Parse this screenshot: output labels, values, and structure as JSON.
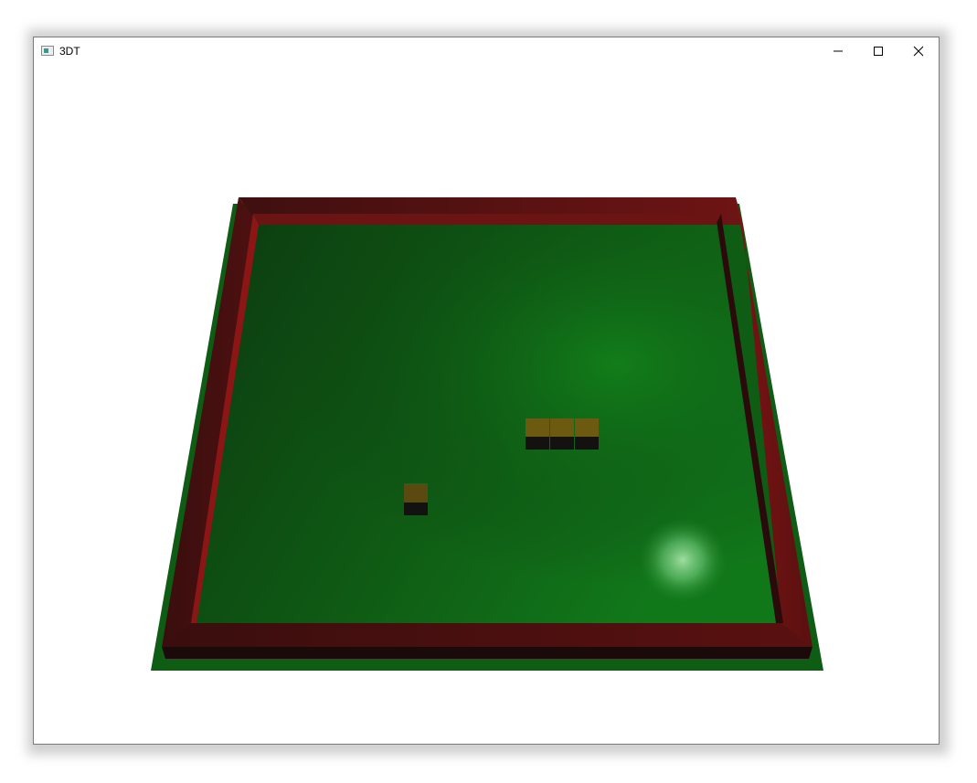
{
  "window": {
    "title": "3DT",
    "controls": {
      "minimize_icon": "minimize-icon",
      "maximize_icon": "maximize-icon",
      "close_icon": "close-icon"
    }
  },
  "scene": {
    "colors": {
      "floor_light": "#127a16",
      "floor_dark": "#0c3a10",
      "floor_edge": "#0f5c14",
      "wall_top": "#6a1414",
      "wall_top_dark": "#3f0f0f",
      "wall_inner": "#8c1616",
      "wall_shadow": "#1a0a0a",
      "block_top": "#6b5a10",
      "block_front": "#141210",
      "glow": "#b8f0b8"
    },
    "snake_segments": 3,
    "food_items": 1
  }
}
